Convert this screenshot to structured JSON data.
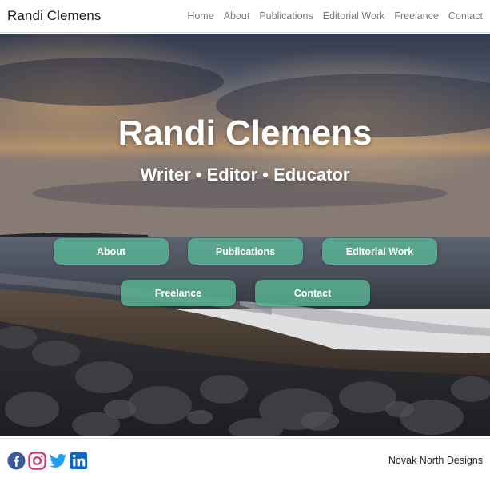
{
  "nav": {
    "brand": "Randi Clemens",
    "links": [
      "Home",
      "About",
      "Publications",
      "Editorial Work",
      "Freelance",
      "Contact"
    ]
  },
  "hero": {
    "title": "Randi Clemens",
    "subtitle": "Writer • Editor • Educator",
    "buttons": [
      "About",
      "Publications",
      "Editorial Work",
      "Freelance",
      "Contact"
    ]
  },
  "footer": {
    "social_icons": [
      "facebook-icon",
      "instagram-icon",
      "twitter-icon",
      "linkedin-icon"
    ],
    "credit": "Novak North Designs"
  },
  "colors": {
    "button": "#5ab496",
    "facebook": "#3b5998",
    "instagram": "#e1306c",
    "twitter": "#1da1f2",
    "linkedin": "#0a66c2"
  }
}
